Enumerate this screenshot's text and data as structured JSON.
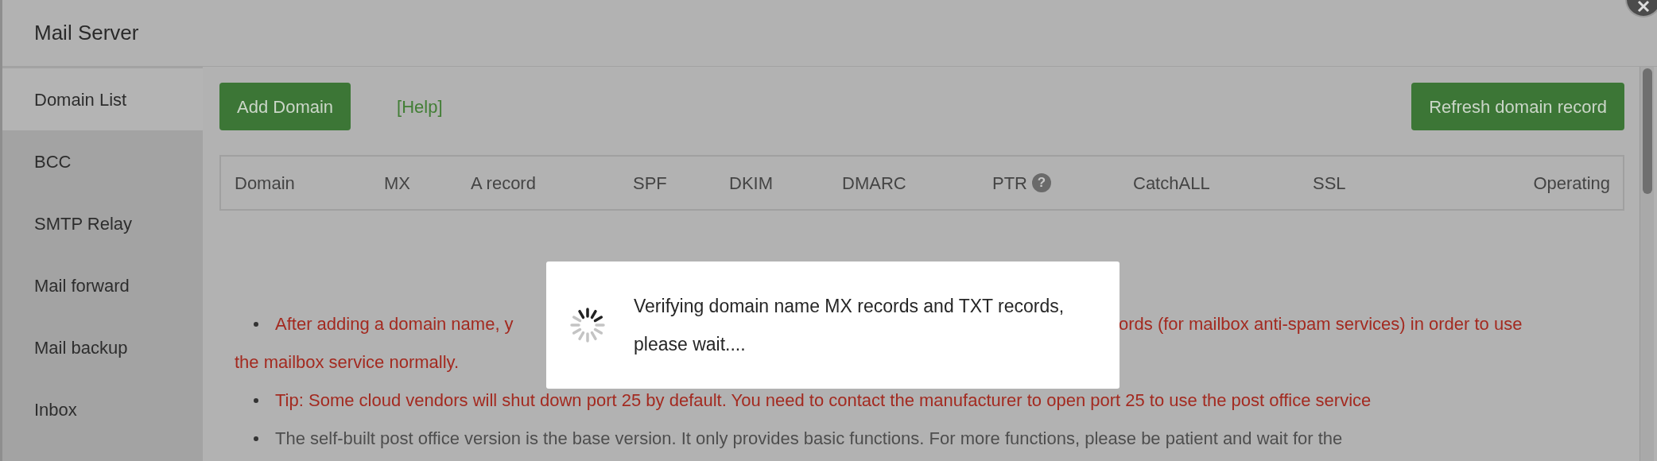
{
  "dialog": {
    "title": "Mail Server"
  },
  "sidebar": {
    "items": [
      {
        "label": "Domain List",
        "selected": true
      },
      {
        "label": "BCC",
        "selected": false
      },
      {
        "label": "SMTP Relay",
        "selected": false
      },
      {
        "label": "Mail forward",
        "selected": false
      },
      {
        "label": "Mail backup",
        "selected": false
      },
      {
        "label": "Inbox",
        "selected": false
      }
    ]
  },
  "toolbar": {
    "add_button": "Add Domain",
    "help_link": "[Help]",
    "refresh_button": "Refresh domain record"
  },
  "table": {
    "columns": [
      {
        "label": "Domain"
      },
      {
        "label": "MX"
      },
      {
        "label": "A record"
      },
      {
        "label": "SPF"
      },
      {
        "label": "DKIM"
      },
      {
        "label": "DMARC"
      },
      {
        "label": "PTR",
        "help_mark": "?"
      },
      {
        "label": "CatchALL"
      },
      {
        "label": "SSL"
      },
      {
        "label": "Operating"
      }
    ]
  },
  "notes": [
    {
      "kind": "warning",
      "parts": [
        "After adding a domain name, y",
        "ords (for mailbox anti-spam services) in order to use"
      ],
      "continuation": "the mailbox service normally."
    },
    {
      "kind": "warning",
      "text": "Tip: Some cloud vendors will shut down port 25 by default. You need to contact the manufacturer to open port 25 to use the post office service"
    },
    {
      "kind": "info",
      "text": "The self-built post office version is the base version. It only provides basic functions. For more functions, please be patient and wait for the"
    }
  ],
  "loading": {
    "message": "Verifying domain name MX records and TXT records, please wait...."
  }
}
